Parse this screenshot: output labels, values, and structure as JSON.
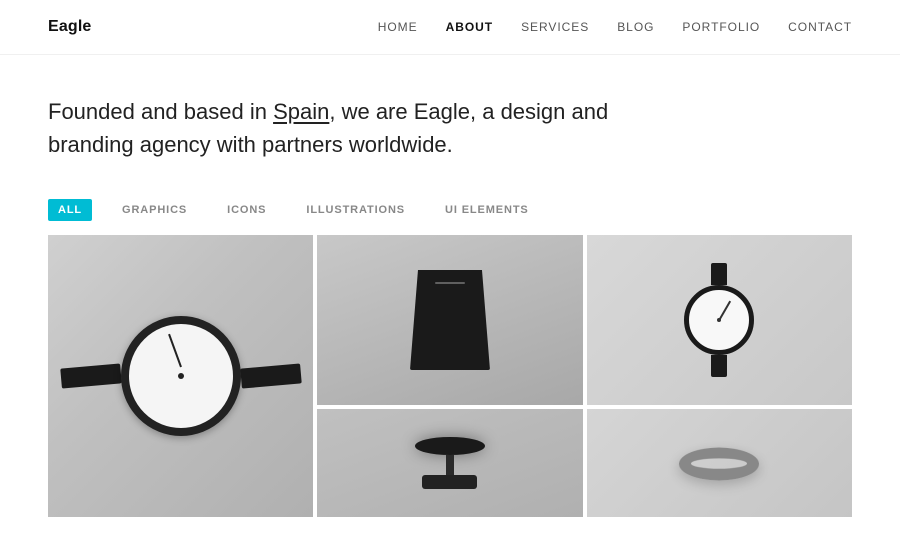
{
  "header": {
    "logo": "Eagle",
    "nav": {
      "home": "HOME",
      "about": "ABOUT",
      "services": "SERVICES",
      "blog": "BLOG",
      "portfolio": "PORTFOLIO",
      "contact": "CONTACT",
      "active": "about"
    }
  },
  "hero": {
    "line1": "Founded and based in ",
    "highlight": "Spain",
    "line2": ", we are Eagle, a design and",
    "line3": "branding agency with partners worldwide."
  },
  "filters": {
    "items": [
      {
        "id": "all",
        "label": "ALL",
        "active": true
      },
      {
        "id": "graphics",
        "label": "GRAPHICS",
        "active": false
      },
      {
        "id": "icons",
        "label": "ICONS",
        "active": false
      },
      {
        "id": "illustrations",
        "label": "ILLUSTRATIONS",
        "active": false
      },
      {
        "id": "ui-elements",
        "label": "UI ELEMENTS",
        "active": false
      }
    ]
  },
  "gallery": {
    "items": [
      {
        "id": "item-1",
        "alt": "Chronograph watch with black strap"
      },
      {
        "id": "item-2",
        "alt": "Black cone speaker"
      },
      {
        "id": "item-3",
        "alt": "Simple minimalist watch"
      },
      {
        "id": "item-4",
        "alt": "Floating disc object"
      },
      {
        "id": "item-5",
        "alt": "Metal ring bracelet"
      }
    ]
  },
  "colors": {
    "accent": "#00bcd4",
    "activeNav": "#111",
    "inactiveNav": "#555"
  }
}
